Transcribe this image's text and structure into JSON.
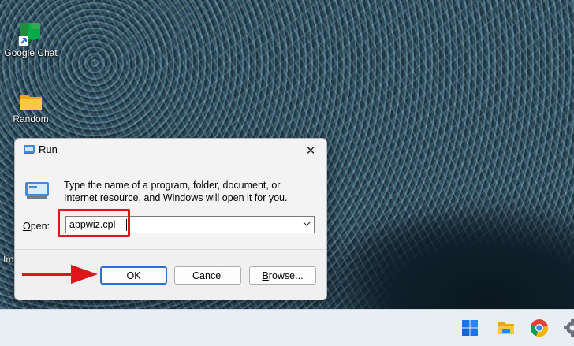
{
  "desktop": {
    "icons": [
      {
        "label": "Google Chat"
      },
      {
        "label": "Random"
      }
    ],
    "partial_label": "Im"
  },
  "run_dialog": {
    "title": "Run",
    "description": "Type the name of a program, folder, document, or Internet resource, and Windows will open it for you.",
    "open_label_prefix": "",
    "open_label_underlined": "O",
    "open_label_rest": "pen:",
    "command_value": "appwiz.cpl",
    "buttons": {
      "ok": "OK",
      "cancel": "Cancel",
      "browse_underlined": "B",
      "browse_rest": "rowse..."
    }
  },
  "colors": {
    "highlight": "#e0141b",
    "arrow": "#e0141b",
    "ok_border": "#2f6dd0"
  },
  "taskbar": {
    "icons": [
      "windows-start-icon",
      "file-explorer-icon",
      "chrome-icon",
      "settings-gear-icon"
    ]
  }
}
